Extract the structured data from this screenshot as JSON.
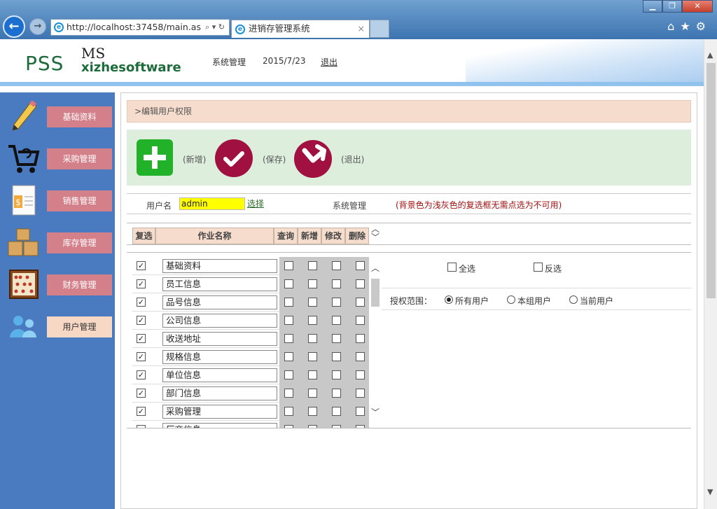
{
  "browser": {
    "url": "http://localhost:37458/main.as",
    "tab_title": "进销存管理系统",
    "tab_close": "×"
  },
  "header": {
    "logo_pss": "PSS",
    "logo_ms": "MS",
    "logo_company": "xizhesoftware",
    "menu_system": "系统管理",
    "date": "2015/7/23",
    "logout": "退出"
  },
  "sidebar": {
    "items": [
      {
        "label": "基础资料",
        "icon": "pencil-icon"
      },
      {
        "label": "采购管理",
        "icon": "cart-icon"
      },
      {
        "label": "销售管理",
        "icon": "invoice-icon"
      },
      {
        "label": "库存管理",
        "icon": "boxes-icon"
      },
      {
        "label": "财务管理",
        "icon": "abacus-icon"
      },
      {
        "label": "用户管理",
        "icon": "users-icon"
      }
    ],
    "active_index": 5
  },
  "breadcrumb": ">编辑用户权限",
  "toolbar": {
    "add_label": "(新增)",
    "save_label": "(保存)",
    "exit_label": "(退出)"
  },
  "user": {
    "name_label": "用户名",
    "name_value": "admin",
    "select_link": "选择",
    "sys_label": "系统管理",
    "note": "(背景色为浅灰色的复选框无需点选为不可用)"
  },
  "table": {
    "headers": {
      "select": "复选",
      "name": "作业名称",
      "query": "查询",
      "add": "新增",
      "edit": "修改",
      "delete": "删除"
    },
    "rows": [
      {
        "checked": "✓",
        "name": "基础资料"
      },
      {
        "checked": "✓",
        "name": "员工信息"
      },
      {
        "checked": "✓",
        "name": "品号信息"
      },
      {
        "checked": "✓",
        "name": "公司信息"
      },
      {
        "checked": "✓",
        "name": "收送地址"
      },
      {
        "checked": "✓",
        "name": "规格信息"
      },
      {
        "checked": "✓",
        "name": "单位信息"
      },
      {
        "checked": "✓",
        "name": "部门信息"
      },
      {
        "checked": "✓",
        "name": "采购管理"
      },
      {
        "checked": "",
        "name": "厂商信息"
      }
    ]
  },
  "right": {
    "select_all": "全选",
    "invert": "反选",
    "scope_label": "授权范围：",
    "scope_options": [
      "所有用户",
      "本组用户",
      "当前用户"
    ],
    "scope_selected": 0
  }
}
